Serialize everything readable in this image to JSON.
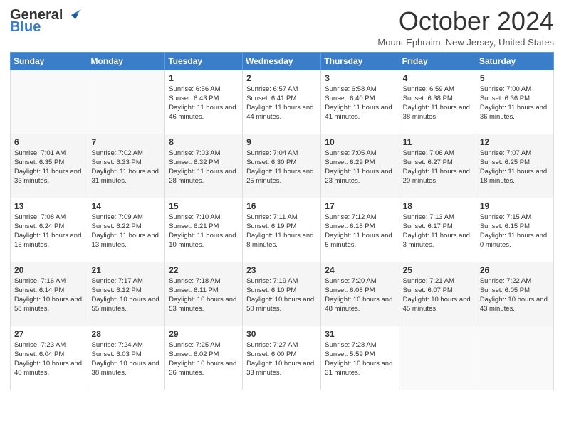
{
  "header": {
    "logo_line1": "General",
    "logo_line2": "Blue",
    "month_title": "October 2024",
    "location": "Mount Ephraim, New Jersey, United States"
  },
  "columns": [
    "Sunday",
    "Monday",
    "Tuesday",
    "Wednesday",
    "Thursday",
    "Friday",
    "Saturday"
  ],
  "weeks": [
    [
      {
        "day": "",
        "info": ""
      },
      {
        "day": "",
        "info": ""
      },
      {
        "day": "1",
        "info": "Sunrise: 6:56 AM\nSunset: 6:43 PM\nDaylight: 11 hours and 46 minutes."
      },
      {
        "day": "2",
        "info": "Sunrise: 6:57 AM\nSunset: 6:41 PM\nDaylight: 11 hours and 44 minutes."
      },
      {
        "day": "3",
        "info": "Sunrise: 6:58 AM\nSunset: 6:40 PM\nDaylight: 11 hours and 41 minutes."
      },
      {
        "day": "4",
        "info": "Sunrise: 6:59 AM\nSunset: 6:38 PM\nDaylight: 11 hours and 38 minutes."
      },
      {
        "day": "5",
        "info": "Sunrise: 7:00 AM\nSunset: 6:36 PM\nDaylight: 11 hours and 36 minutes."
      }
    ],
    [
      {
        "day": "6",
        "info": "Sunrise: 7:01 AM\nSunset: 6:35 PM\nDaylight: 11 hours and 33 minutes."
      },
      {
        "day": "7",
        "info": "Sunrise: 7:02 AM\nSunset: 6:33 PM\nDaylight: 11 hours and 31 minutes."
      },
      {
        "day": "8",
        "info": "Sunrise: 7:03 AM\nSunset: 6:32 PM\nDaylight: 11 hours and 28 minutes."
      },
      {
        "day": "9",
        "info": "Sunrise: 7:04 AM\nSunset: 6:30 PM\nDaylight: 11 hours and 25 minutes."
      },
      {
        "day": "10",
        "info": "Sunrise: 7:05 AM\nSunset: 6:29 PM\nDaylight: 11 hours and 23 minutes."
      },
      {
        "day": "11",
        "info": "Sunrise: 7:06 AM\nSunset: 6:27 PM\nDaylight: 11 hours and 20 minutes."
      },
      {
        "day": "12",
        "info": "Sunrise: 7:07 AM\nSunset: 6:25 PM\nDaylight: 11 hours and 18 minutes."
      }
    ],
    [
      {
        "day": "13",
        "info": "Sunrise: 7:08 AM\nSunset: 6:24 PM\nDaylight: 11 hours and 15 minutes."
      },
      {
        "day": "14",
        "info": "Sunrise: 7:09 AM\nSunset: 6:22 PM\nDaylight: 11 hours and 13 minutes."
      },
      {
        "day": "15",
        "info": "Sunrise: 7:10 AM\nSunset: 6:21 PM\nDaylight: 11 hours and 10 minutes."
      },
      {
        "day": "16",
        "info": "Sunrise: 7:11 AM\nSunset: 6:19 PM\nDaylight: 11 hours and 8 minutes."
      },
      {
        "day": "17",
        "info": "Sunrise: 7:12 AM\nSunset: 6:18 PM\nDaylight: 11 hours and 5 minutes."
      },
      {
        "day": "18",
        "info": "Sunrise: 7:13 AM\nSunset: 6:17 PM\nDaylight: 11 hours and 3 minutes."
      },
      {
        "day": "19",
        "info": "Sunrise: 7:15 AM\nSunset: 6:15 PM\nDaylight: 11 hours and 0 minutes."
      }
    ],
    [
      {
        "day": "20",
        "info": "Sunrise: 7:16 AM\nSunset: 6:14 PM\nDaylight: 10 hours and 58 minutes."
      },
      {
        "day": "21",
        "info": "Sunrise: 7:17 AM\nSunset: 6:12 PM\nDaylight: 10 hours and 55 minutes."
      },
      {
        "day": "22",
        "info": "Sunrise: 7:18 AM\nSunset: 6:11 PM\nDaylight: 10 hours and 53 minutes."
      },
      {
        "day": "23",
        "info": "Sunrise: 7:19 AM\nSunset: 6:10 PM\nDaylight: 10 hours and 50 minutes."
      },
      {
        "day": "24",
        "info": "Sunrise: 7:20 AM\nSunset: 6:08 PM\nDaylight: 10 hours and 48 minutes."
      },
      {
        "day": "25",
        "info": "Sunrise: 7:21 AM\nSunset: 6:07 PM\nDaylight: 10 hours and 45 minutes."
      },
      {
        "day": "26",
        "info": "Sunrise: 7:22 AM\nSunset: 6:05 PM\nDaylight: 10 hours and 43 minutes."
      }
    ],
    [
      {
        "day": "27",
        "info": "Sunrise: 7:23 AM\nSunset: 6:04 PM\nDaylight: 10 hours and 40 minutes."
      },
      {
        "day": "28",
        "info": "Sunrise: 7:24 AM\nSunset: 6:03 PM\nDaylight: 10 hours and 38 minutes."
      },
      {
        "day": "29",
        "info": "Sunrise: 7:25 AM\nSunset: 6:02 PM\nDaylight: 10 hours and 36 minutes."
      },
      {
        "day": "30",
        "info": "Sunrise: 7:27 AM\nSunset: 6:00 PM\nDaylight: 10 hours and 33 minutes."
      },
      {
        "day": "31",
        "info": "Sunrise: 7:28 AM\nSunset: 5:59 PM\nDaylight: 10 hours and 31 minutes."
      },
      {
        "day": "",
        "info": ""
      },
      {
        "day": "",
        "info": ""
      }
    ]
  ]
}
